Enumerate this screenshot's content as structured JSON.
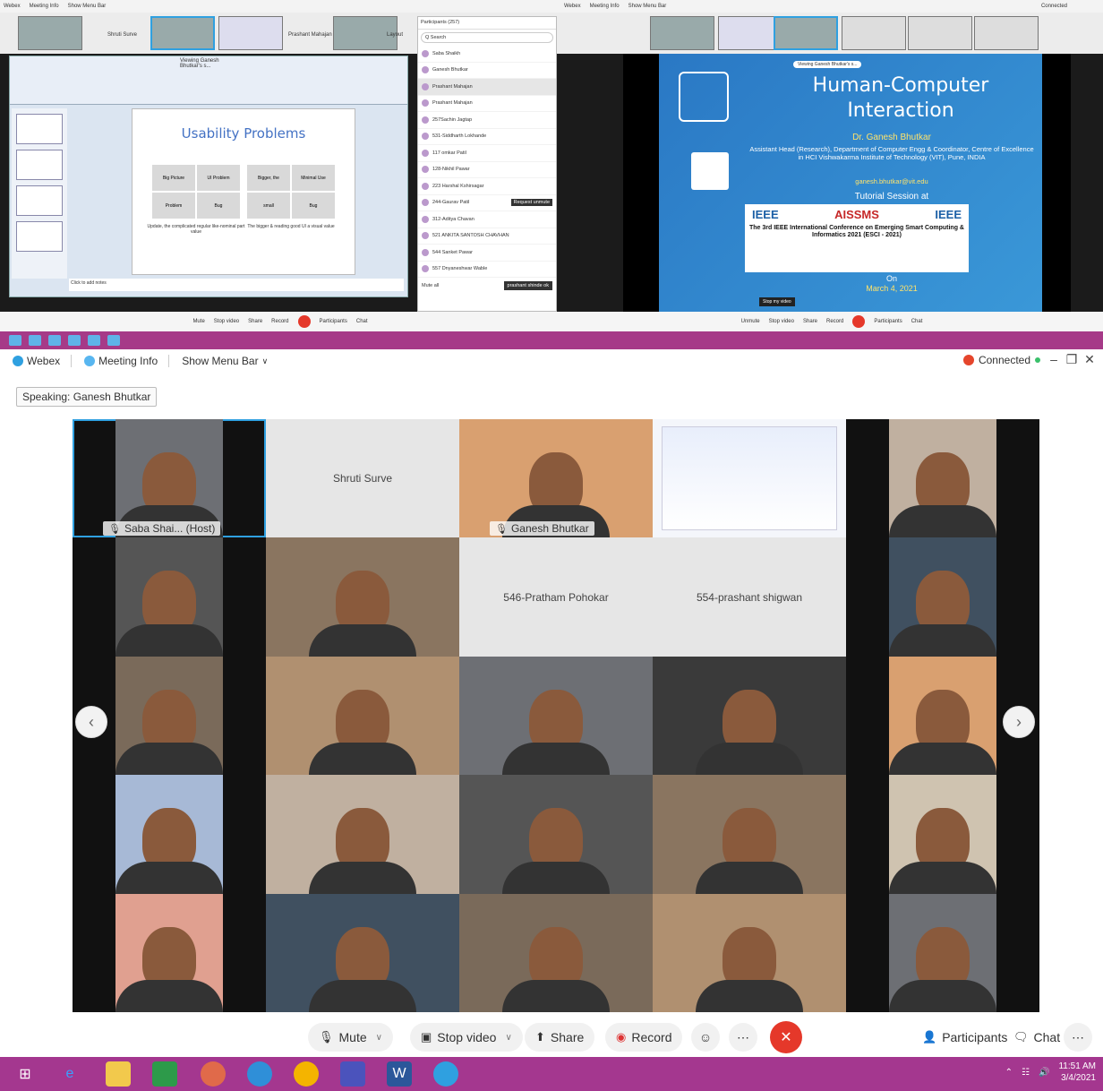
{
  "top_left": {
    "menu": [
      "Webex",
      "Meeting Info",
      "Show Menu Bar"
    ],
    "strip_names": [
      "Shruti Surve",
      "Ganesh Bhutkar",
      "Prashant Mahajan",
      "Layout"
    ],
    "ppt": {
      "title_bar": "Viewing Ganesh Bhutkar's s...",
      "slide_title": "Usability Problems",
      "grid_left": [
        "Big Picture",
        "UI Problem",
        "Problem",
        "Bug"
      ],
      "grid_right": [
        "Bigger, the",
        "Minimal Use",
        "small",
        "Bug"
      ],
      "caption_left": "Update, the complicated regular like-nominal part value",
      "caption_right": "The bigger & reading good UI a visual value",
      "notes": "Click to add notes"
    },
    "participants": {
      "header": "Participants (257)",
      "search": "Q Search",
      "rows": [
        "Saba Shaikh",
        "Ganesh Bhutkar",
        "Prashant Mahajan",
        "Prashant Mahajan",
        "257Sachin Jagtap",
        "531-Siddharth Lokhande",
        "117 omkar Patil",
        "128-Nikhil Pawar",
        "223 Harshal Kshirsagar",
        "244-Gaurav Patil",
        "312-Aditya Chavan",
        "521 ANKITA SANTOSH CHAVHAN",
        "544 Sanket Pawar",
        "557 Dnyaneshwar Wable"
      ],
      "request_btn": "Request unmute",
      "mute_all": "Mute all",
      "mini_popup": "prashant shinde ok"
    },
    "toolbar": [
      "Mute",
      "Stop video",
      "Share",
      "Record",
      "Participants",
      "Chat"
    ]
  },
  "top_right": {
    "menu": [
      "Webex",
      "Meeting Info",
      "Show Menu Bar"
    ],
    "connected": "Connected",
    "viewing_pill": "Viewing Ganesh Bhutkar's s...",
    "slide": {
      "title": "Human-Computer Interaction",
      "speaker": "Dr. Ganesh Bhutkar",
      "affiliation": "Assistant Head (Research), Department of Computer Engg & Coordinator, Centre of Excellence in HCI Vishwakarma Institute of Technology (VIT), Pune, INDIA",
      "email": "ganesh.bhutkar@vit.edu",
      "tutorial": "Tutorial Session at",
      "logos": [
        "IEEE",
        "AISSMS",
        "IEEE"
      ],
      "conf_title": "The 3rd IEEE International Conference on Emerging Smart Computing & Informatics 2021 (ESCI - 2021)",
      "on": "On",
      "date": "March 4, 2021"
    },
    "stop_view": "Stop my video",
    "toolbar": [
      "Unmute",
      "Stop video",
      "Share",
      "Record",
      "Participants",
      "Chat"
    ]
  },
  "main": {
    "menu": {
      "webex": "Webex",
      "meeting_info": "Meeting Info",
      "show_menu_bar": "Show Menu Bar"
    },
    "connected": "Connected",
    "speaking": "Speaking: Ganesh Bhutkar",
    "tiles": [
      {
        "type": "video",
        "name": "Saba Shai... (Host)",
        "active": true
      },
      {
        "type": "name",
        "name": "Shruti Surve"
      },
      {
        "type": "video",
        "name": "Ganesh Bhutkar",
        "active": true
      },
      {
        "type": "share"
      },
      {
        "type": "video"
      },
      {
        "type": "video"
      },
      {
        "type": "video"
      },
      {
        "type": "name",
        "name": "546-Pratham Pohokar"
      },
      {
        "type": "name",
        "name": "554-prashant shigwan"
      },
      {
        "type": "video"
      },
      {
        "type": "video"
      },
      {
        "type": "video"
      },
      {
        "type": "video"
      },
      {
        "type": "video"
      },
      {
        "type": "video"
      },
      {
        "type": "video"
      },
      {
        "type": "video"
      },
      {
        "type": "video"
      },
      {
        "type": "video"
      },
      {
        "type": "video"
      },
      {
        "type": "video"
      },
      {
        "type": "video"
      },
      {
        "type": "video"
      },
      {
        "type": "video"
      },
      {
        "type": "video"
      }
    ],
    "toolbar": {
      "mute": "Mute",
      "stop_video": "Stop video",
      "share": "Share",
      "record": "Record",
      "participants": "Participants",
      "chat": "Chat"
    }
  },
  "taskbar": {
    "time": "11:51 AM",
    "date": "3/4/2021"
  }
}
